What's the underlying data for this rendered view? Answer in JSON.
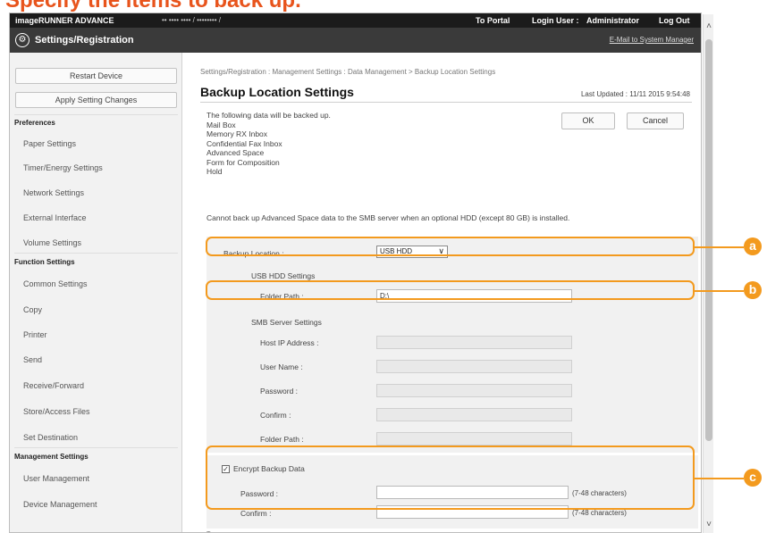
{
  "heading": "Specify the items to back up.",
  "header": {
    "brand": "imageRUNNER ADVANCE",
    "device_name": "•• •••• •••• / •••••••• /",
    "portal": "To Portal",
    "login_label": "Login User :",
    "login_user": "Administrator",
    "logout": "Log Out",
    "page_title": "Settings/Registration",
    "mail_link": "E-Mail to System Manager"
  },
  "sidebar": {
    "restart": "Restart Device",
    "apply": "Apply Setting Changes",
    "sections": [
      {
        "title": "Preferences",
        "items": [
          "Paper Settings",
          "Timer/Energy Settings",
          "Network Settings",
          "External Interface",
          "Volume Settings"
        ]
      },
      {
        "title": "Function Settings",
        "items": [
          "Common Settings",
          "Copy",
          "Printer",
          "Send",
          "Receive/Forward",
          "Store/Access Files",
          "Set Destination"
        ]
      },
      {
        "title": "Management Settings",
        "items": [
          "User Management",
          "Device Management"
        ]
      }
    ]
  },
  "main": {
    "breadcrumb": "Settings/Registration : Management Settings : Data Management > Backup Location Settings",
    "title": "Backup Location Settings",
    "last_updated": "Last Updated : 11/11 2015 9:54:48",
    "ok": "OK",
    "cancel": "Cancel",
    "intro": [
      "The following data will be backed up.",
      "Mail Box",
      "Memory RX Inbox",
      "Confidential Fax Inbox",
      "Advanced Space",
      "Form for Composition",
      "Hold"
    ],
    "note": "Cannot back up Advanced Space data to the SMB server when an optional HDD (except 80 GB) is installed.",
    "backup_location_label": "Backup Location :",
    "backup_location_value": "USB HDD",
    "usb_section": "USB HDD Settings",
    "usb_folder_label": "Folder Path :",
    "usb_folder_value": "D:\\",
    "smb_section": "SMB Server Settings",
    "smb_host_label": "Host IP Address :",
    "smb_user_label": "User Name :",
    "smb_password_label": "Password :",
    "smb_confirm_label": "Confirm :",
    "smb_folder_label": "Folder Path :",
    "encrypt_label": "Encrypt Backup Data",
    "encrypt_checked": true,
    "enc_password_label": "Password :",
    "enc_confirm_label": "Confirm :",
    "enc_hint": "(7-48 characters)"
  },
  "callouts": [
    "a",
    "b",
    "c"
  ],
  "colors": {
    "accent": "#f39a1e",
    "heading": "#e8541c",
    "header_bg": "#1b1b1b"
  }
}
